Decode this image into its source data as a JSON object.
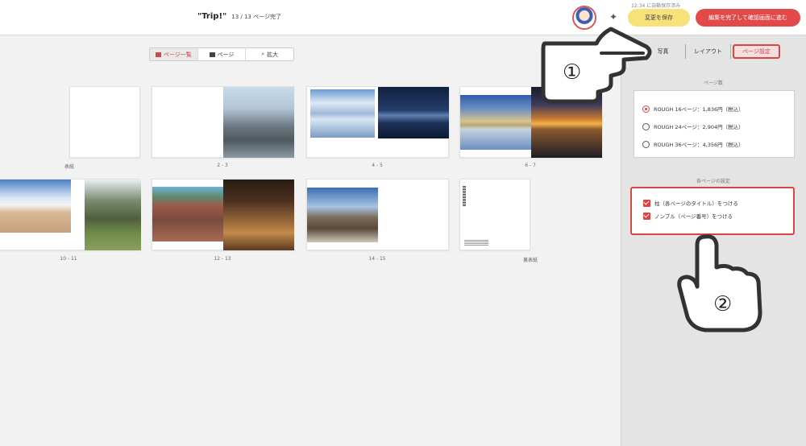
{
  "header": {
    "title": "\"Trip!\"",
    "page_count": "13 / 13 ページ完了",
    "autosave_note": "12:34 に自動保存済み",
    "save_label": "変更を保存",
    "finish_label": "編集を完了して確認画面に進む"
  },
  "view_switch": [
    {
      "label": "ページ一覧",
      "active": true
    },
    {
      "label": "ページ",
      "active": false
    },
    {
      "label": "拡大",
      "active": false
    }
  ],
  "spreads": [
    {
      "label": "表紙"
    },
    {
      "label": "2 - 3"
    },
    {
      "label": "4 - 5"
    },
    {
      "label": "6 - 7"
    },
    {
      "label": "10 - 11"
    },
    {
      "label": "12 - 13"
    },
    {
      "label": "14 - 15"
    },
    {
      "label": "裏表紙"
    }
  ],
  "panel": {
    "tabs": [
      {
        "label": "写真",
        "active": false
      },
      {
        "label": "レイアウト",
        "active": false
      },
      {
        "label": "ページ設定",
        "active": true
      }
    ],
    "page_count_title": "ページ数",
    "page_options": [
      {
        "label": "ROUGH 16ページ：1,836円（税込）",
        "selected": true
      },
      {
        "label": "ROUGH 24ページ：2,904円（税込）",
        "selected": false
      },
      {
        "label": "ROUGH 36ページ：4,356円（税込）",
        "selected": false
      }
    ],
    "settings_title": "各ページの設定",
    "settings": [
      {
        "label": "柱（各ページのタイトル）をつける",
        "checked": true
      },
      {
        "label": "ノンブル（ページ番号）をつける",
        "checked": true
      }
    ]
  },
  "annotations": {
    "step1": "①",
    "step2": "②"
  },
  "colors": {
    "accent": "#d94545",
    "save_button": "#f7e27a",
    "finish_button": "#e24a4a"
  }
}
